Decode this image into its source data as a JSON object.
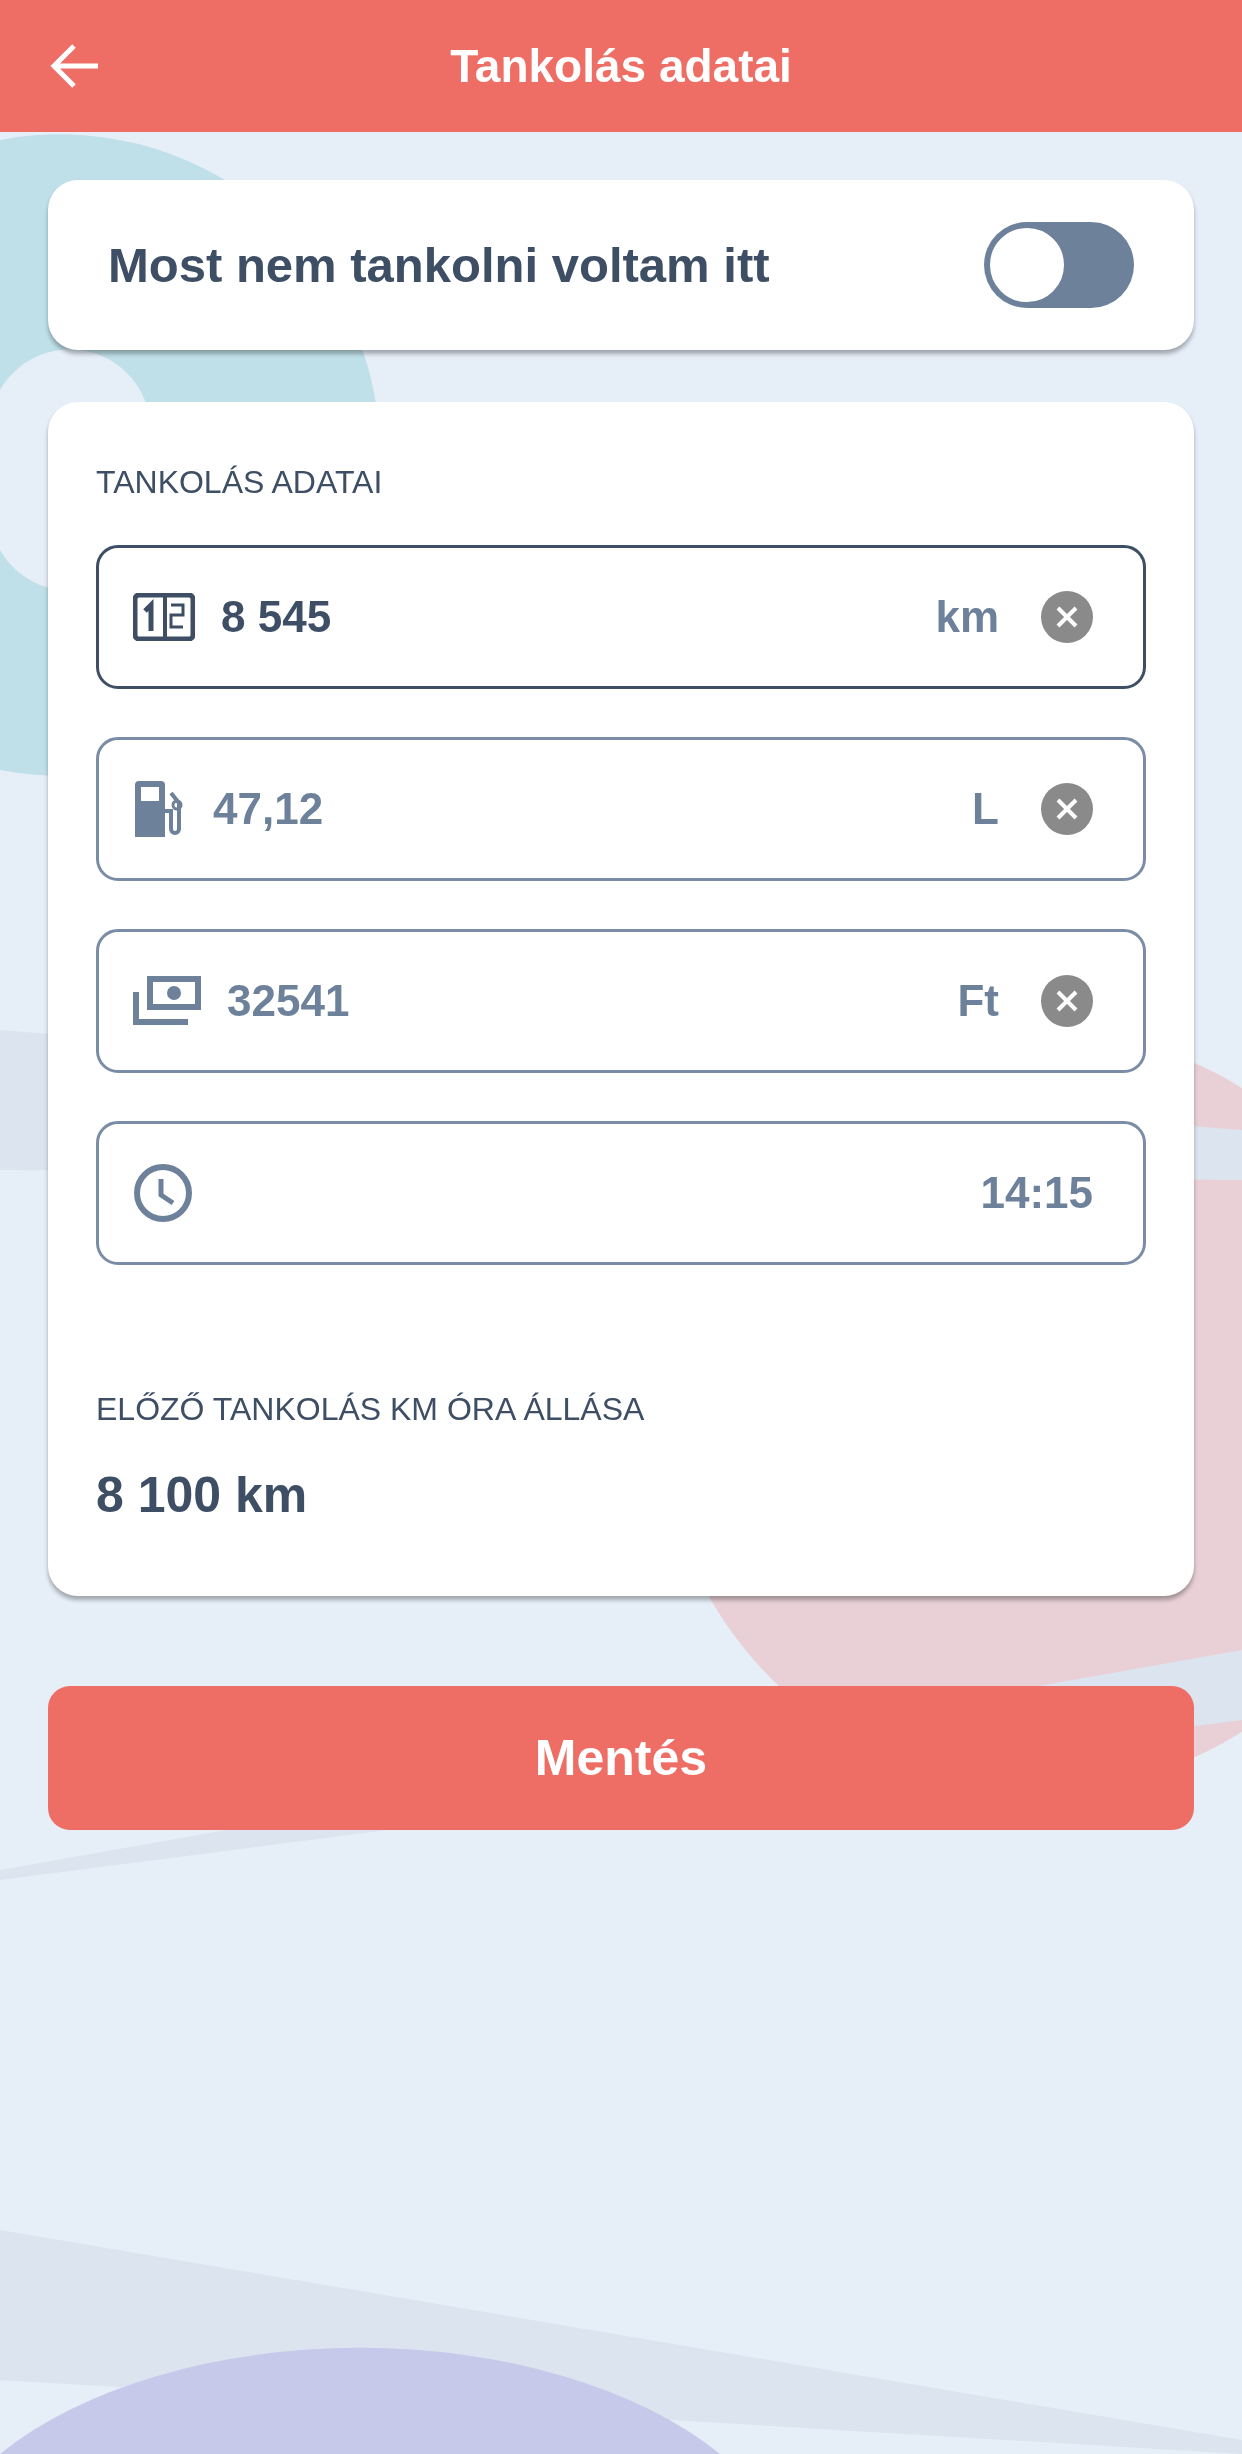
{
  "header": {
    "title": "Tankolás adatai"
  },
  "toggle_card": {
    "label": "Most nem tankolni voltam itt",
    "on": false
  },
  "form": {
    "section_title": "TANKOLÁS ADATAI",
    "fields": [
      {
        "kind": "odometer",
        "value": "8 545",
        "unit": "km",
        "clearable": true,
        "focused": true
      },
      {
        "kind": "fuel",
        "value": "47,12",
        "unit": "L",
        "clearable": true,
        "focused": false
      },
      {
        "kind": "money",
        "value": "32541",
        "unit": "Ft",
        "clearable": true,
        "focused": false
      },
      {
        "kind": "time",
        "value": "14:15",
        "clearable": false,
        "focused": false
      }
    ],
    "previous_label": "ELŐZŐ TANKOLÁS KM ÓRA ÁLLÁSA",
    "previous_value": "8 100 km"
  },
  "save_button": "Mentés"
}
